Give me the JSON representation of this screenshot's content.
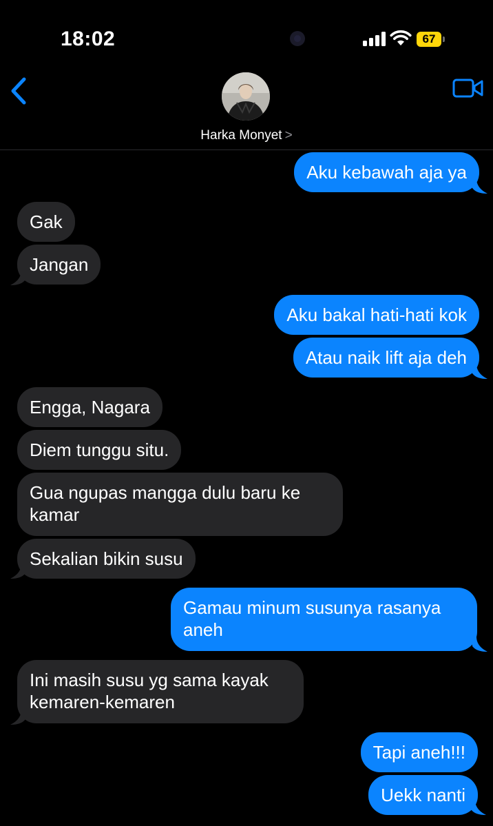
{
  "status_bar": {
    "time": "18:02",
    "battery": "67",
    "battery_color": "#ffd60a"
  },
  "header": {
    "contact_name": "Harka Monyet",
    "chevron": ">",
    "back_icon": "chevron-left-icon",
    "video_icon": "video-camera-icon",
    "accent_color": "#0b84fe"
  },
  "messages": [
    {
      "dir": "out",
      "text": "Aku kebawah aja ya"
    },
    {
      "dir": "in",
      "text": "Gak"
    },
    {
      "dir": "in",
      "text": "Jangan"
    },
    {
      "dir": "out",
      "text": "Aku bakal hati-hati kok"
    },
    {
      "dir": "out",
      "text": "Atau naik lift aja deh"
    },
    {
      "dir": "in",
      "text": "Engga, Nagara"
    },
    {
      "dir": "in",
      "text": "Diem tunggu situ."
    },
    {
      "dir": "in",
      "text": "Gua ngupas mangga dulu baru ke kamar"
    },
    {
      "dir": "in",
      "text": "Sekalian bikin susu"
    },
    {
      "dir": "out",
      "text": "Gamau minum susunya rasanya aneh"
    },
    {
      "dir": "in",
      "text": "Ini masih susu yg sama kayak kemaren-kemaren"
    },
    {
      "dir": "out",
      "text": "Tapi aneh!!!"
    },
    {
      "dir": "out",
      "text": "Uekk nanti"
    }
  ],
  "colors": {
    "outgoing_bubble": "#0b84fe",
    "incoming_bubble": "#262628",
    "background": "#000000"
  }
}
